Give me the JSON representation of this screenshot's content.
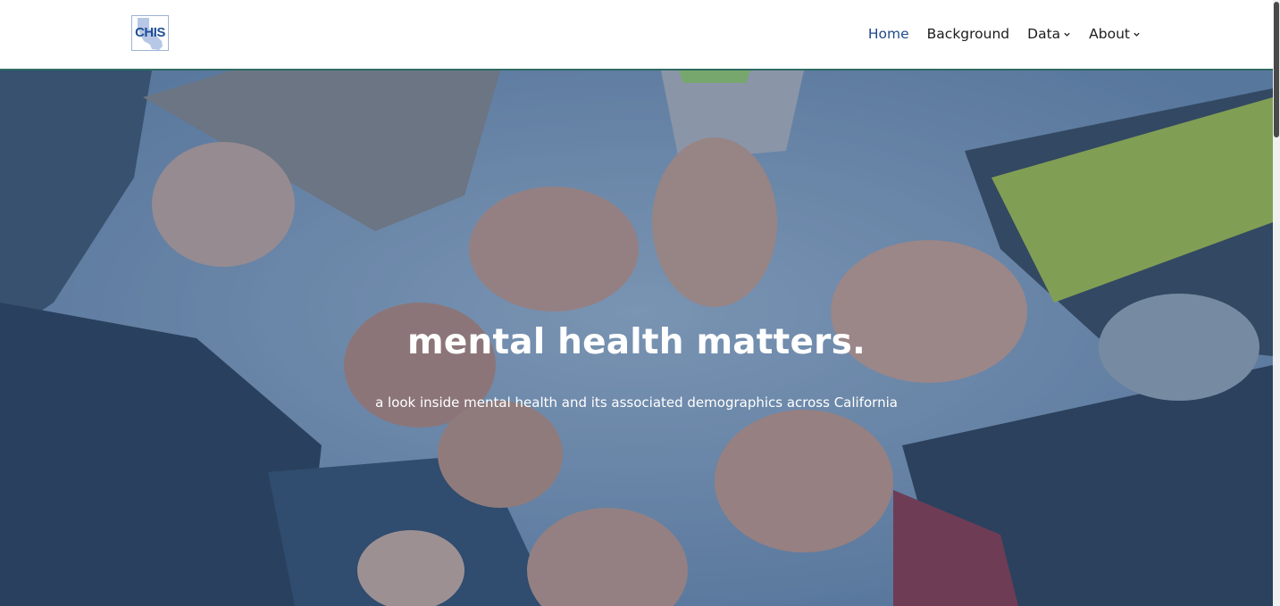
{
  "header": {
    "logo_text": "CHIS",
    "nav": [
      {
        "label": "Home",
        "active": true,
        "has_dropdown": false
      },
      {
        "label": "Background",
        "active": false,
        "has_dropdown": false
      },
      {
        "label": "Data",
        "active": false,
        "has_dropdown": true
      },
      {
        "label": "About",
        "active": false,
        "has_dropdown": true
      }
    ]
  },
  "hero": {
    "title": "mental health matters.",
    "subtitle": "a look inside mental health and its associated demographics across California"
  },
  "colors": {
    "active_nav": "#1f4a8a",
    "header_border": "#2f6b63",
    "hero_tint": "#264670"
  },
  "icons": {
    "dropdown": "chevron-down-icon"
  }
}
